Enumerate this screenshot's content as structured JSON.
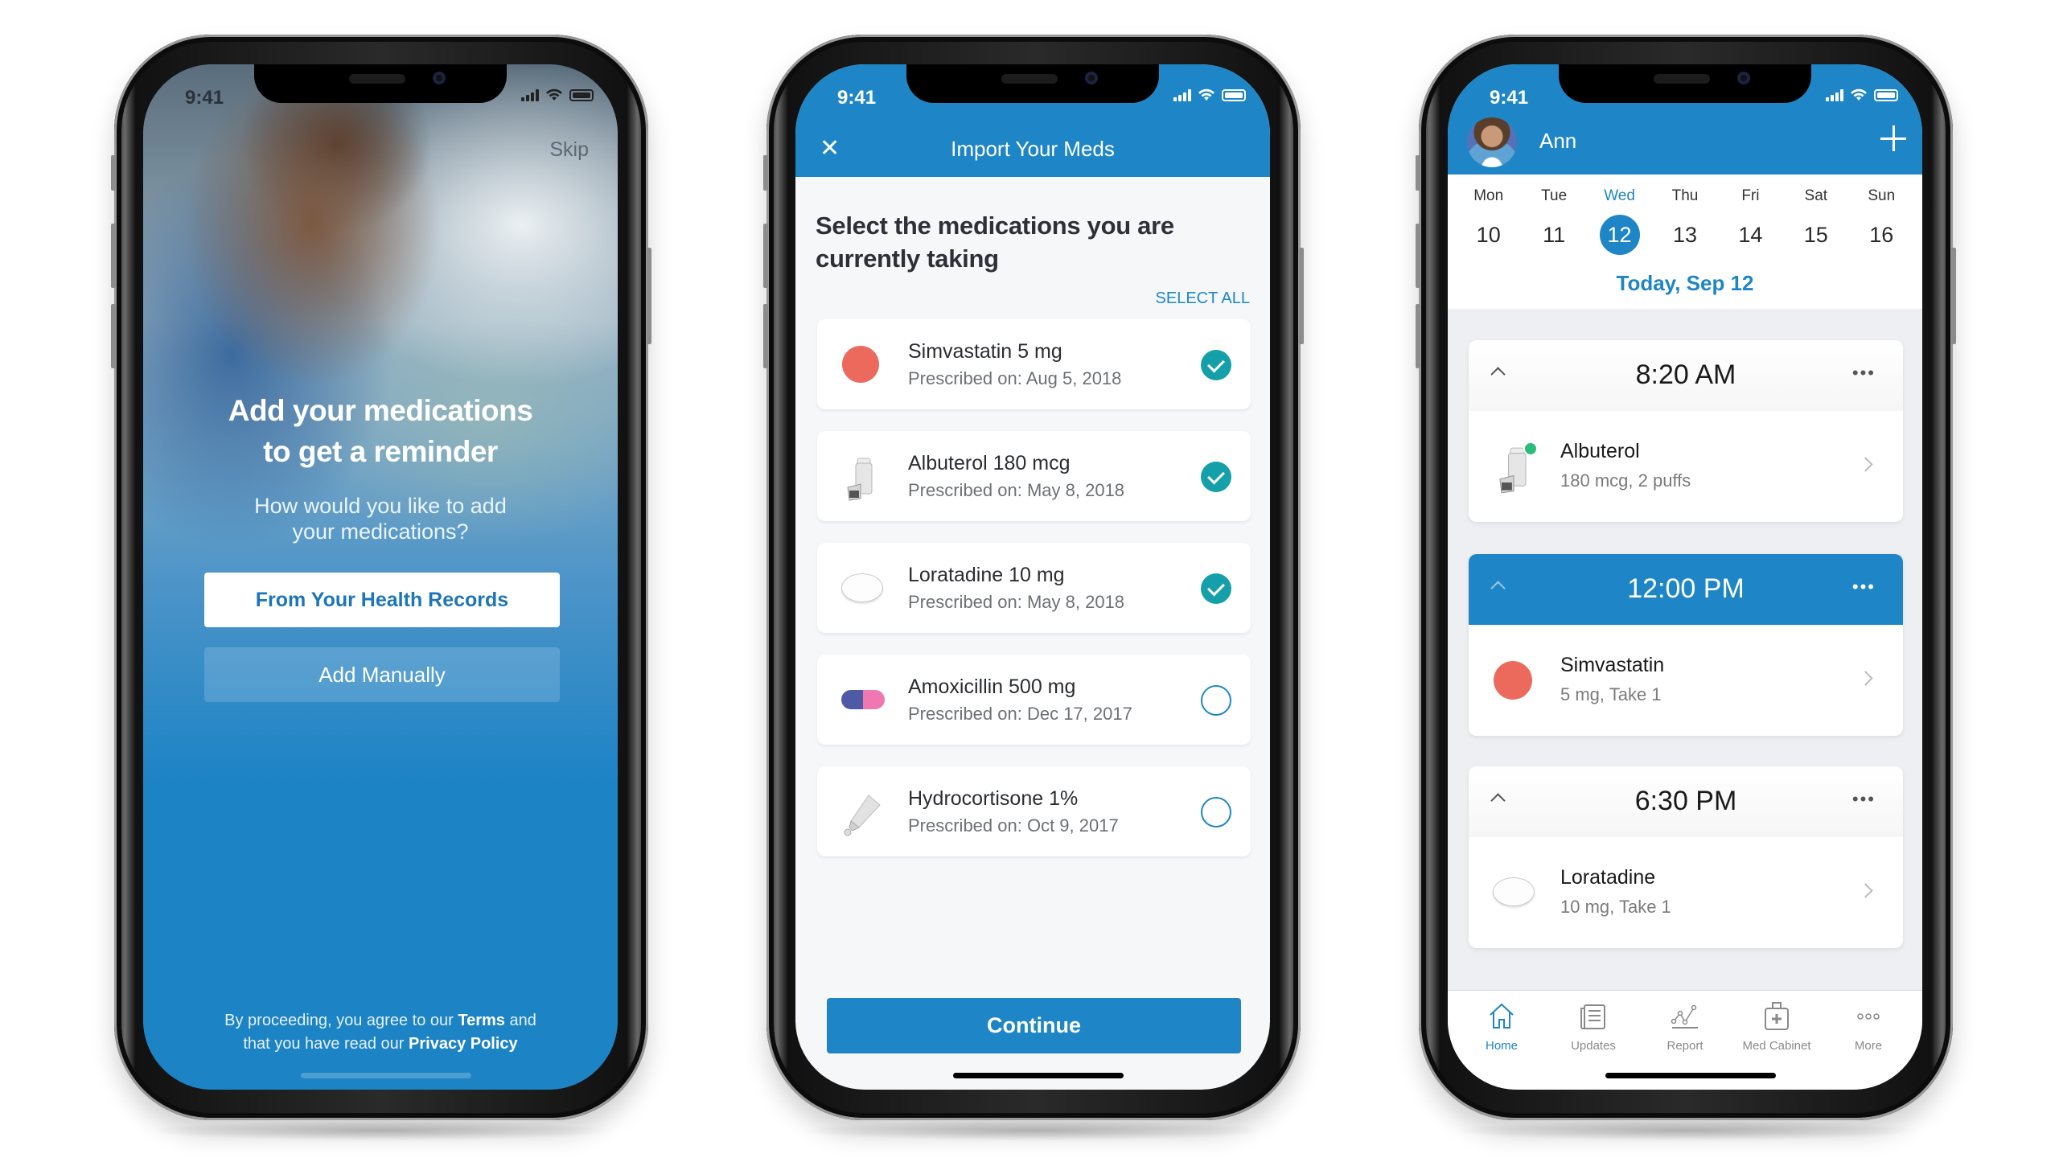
{
  "colors": {
    "brand_blue": "#1e86c6",
    "check_teal": "#15a0a9",
    "pill_red": "#ec6a5c",
    "taken_green": "#2bbd79"
  },
  "status_bar": {
    "time": "9:41",
    "icons": [
      "signal-icon",
      "wifi-icon",
      "battery-icon"
    ]
  },
  "onboarding": {
    "skip_label": "Skip",
    "title_line1": "Add your medications",
    "title_line2": "to get a reminder",
    "subtitle_line1": "How would you like to add",
    "subtitle_line2": "your medications?",
    "primary_button": "From Your Health Records",
    "secondary_button": "Add Manually",
    "legal": {
      "prefix": "By proceeding, you agree to our ",
      "terms_link": "Terms",
      "middle": " and",
      "line2_prefix": "that you have read our ",
      "privacy_link": "Privacy Policy"
    }
  },
  "import_meds": {
    "nav_title": "Import Your Meds",
    "close_icon": "close-icon",
    "heading": "Select the medications you are currently taking",
    "select_all": "SELECT ALL",
    "medications": [
      {
        "name": "Simvastatin 5 mg",
        "prescribed": "Prescribed on: Aug 5, 2018",
        "icon": "red-pill",
        "selected": true
      },
      {
        "name": "Albuterol 180 mcg",
        "prescribed": "Prescribed on: May 8, 2018",
        "icon": "inhaler",
        "selected": true
      },
      {
        "name": "Loratadine 10 mg",
        "prescribed": "Prescribed on: May 8, 2018",
        "icon": "white-pill",
        "selected": true
      },
      {
        "name": "Amoxicillin 500 mg",
        "prescribed": "Prescribed on: Dec 17, 2017",
        "icon": "capsule",
        "selected": false
      },
      {
        "name": "Hydrocortisone 1%",
        "prescribed": "Prescribed on: Oct 9, 2017",
        "icon": "cream-tube",
        "selected": false
      }
    ],
    "continue_label": "Continue"
  },
  "home": {
    "user_name": "Ann",
    "add_icon": "plus-icon",
    "week": [
      {
        "day": "Mon",
        "date": "10",
        "selected": false
      },
      {
        "day": "Tue",
        "date": "11",
        "selected": false
      },
      {
        "day": "Wed",
        "date": "12",
        "selected": true
      },
      {
        "day": "Thu",
        "date": "13",
        "selected": false
      },
      {
        "day": "Fri",
        "date": "14",
        "selected": false
      },
      {
        "day": "Sat",
        "date": "15",
        "selected": false
      },
      {
        "day": "Sun",
        "date": "16",
        "selected": false
      }
    ],
    "today_label": "Today, Sep 12",
    "schedule": [
      {
        "time": "8:20 AM",
        "active": false,
        "med_name": "Albuterol",
        "dose": "180 mcg, 2 puffs",
        "icon": "inhaler",
        "taken": true
      },
      {
        "time": "12:00 PM",
        "active": true,
        "med_name": "Simvastatin",
        "dose": "5 mg, Take 1",
        "icon": "red-pill",
        "taken": false
      },
      {
        "time": "6:30 PM",
        "active": false,
        "med_name": "Loratadine",
        "dose": "10 mg, Take 1",
        "icon": "white-pill",
        "taken": false
      }
    ],
    "more_label": "•••",
    "tabs": [
      {
        "label": "Home",
        "icon": "home-icon",
        "active": true
      },
      {
        "label": "Updates",
        "icon": "updates-icon",
        "active": false
      },
      {
        "label": "Report",
        "icon": "report-icon",
        "active": false
      },
      {
        "label": "Med Cabinet",
        "icon": "med-cabinet-icon",
        "active": false
      },
      {
        "label": "More",
        "icon": "more-icon",
        "active": false
      }
    ]
  }
}
